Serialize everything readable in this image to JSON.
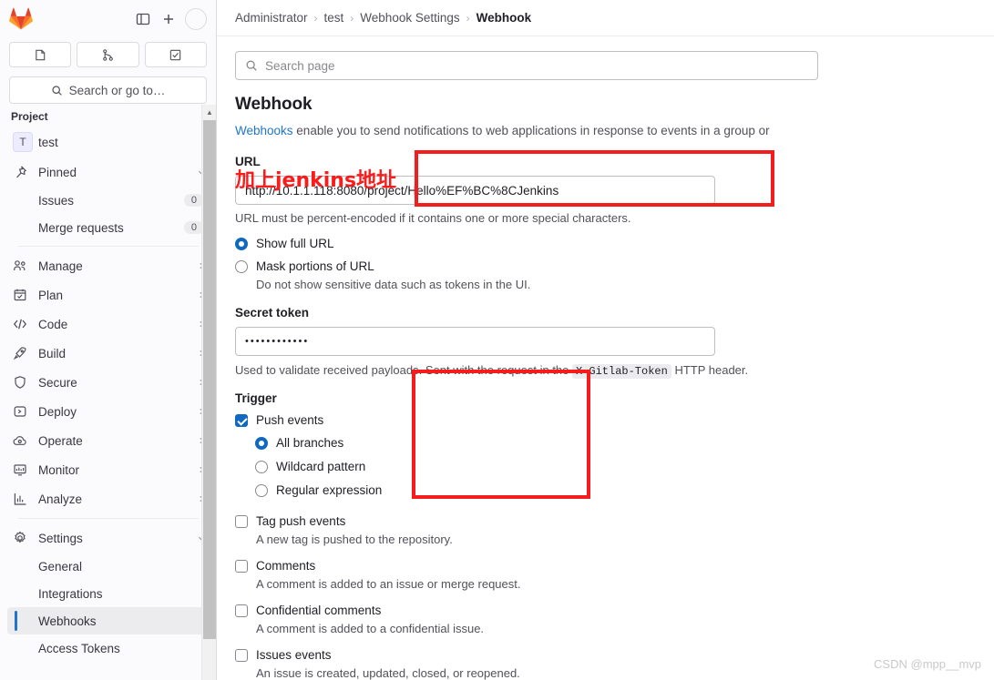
{
  "sidebar": {
    "logo_icon": "gitlab-fox-logo",
    "toggle_icon": "sidebar-toggle-icon",
    "new_icon": "plus-icon",
    "avatar_icon": "user-avatar",
    "quick_actions": [
      {
        "name": "issues",
        "icon": "issue-icon"
      },
      {
        "name": "merge-requests",
        "icon": "merge-request-icon"
      },
      {
        "name": "todos",
        "icon": "todo-checkbox-icon"
      }
    ],
    "search": {
      "label": "Search or go to…",
      "icon": "search-icon"
    },
    "section_label": "Project",
    "project": {
      "initial": "T",
      "name": "test"
    },
    "pinned": {
      "label": "Pinned",
      "icon": "pin-icon",
      "chevron": "chevron-down-icon",
      "items": [
        {
          "label": "Issues",
          "count": "0"
        },
        {
          "label": "Merge requests",
          "count": "0"
        }
      ]
    },
    "groups": [
      {
        "label": "Manage",
        "icon": "users-icon",
        "chevron": "chevron-right-icon"
      },
      {
        "label": "Plan",
        "icon": "calendar-icon",
        "chevron": "chevron-right-icon"
      },
      {
        "label": "Code",
        "icon": "code-icon",
        "chevron": "chevron-right-icon"
      },
      {
        "label": "Build",
        "icon": "rocket-icon",
        "chevron": "chevron-right-icon"
      },
      {
        "label": "Secure",
        "icon": "shield-icon",
        "chevron": "chevron-right-icon"
      },
      {
        "label": "Deploy",
        "icon": "deploy-icon",
        "chevron": "chevron-right-icon"
      },
      {
        "label": "Operate",
        "icon": "cloud-gear-icon",
        "chevron": "chevron-right-icon"
      },
      {
        "label": "Monitor",
        "icon": "monitor-icon",
        "chevron": "chevron-right-icon"
      },
      {
        "label": "Analyze",
        "icon": "chart-icon",
        "chevron": "chevron-right-icon"
      }
    ],
    "settings": {
      "label": "Settings",
      "icon": "gear-icon",
      "chevron": "chevron-down-icon",
      "items": [
        {
          "label": "General",
          "active": false
        },
        {
          "label": "Integrations",
          "active": false
        },
        {
          "label": "Webhooks",
          "active": true
        },
        {
          "label": "Access Tokens",
          "active": false
        }
      ]
    }
  },
  "breadcrumb": {
    "items": [
      "Administrator",
      "test",
      "Webhook Settings"
    ],
    "current": "Webhook",
    "separator": "›"
  },
  "search_page": {
    "placeholder": "Search page",
    "icon": "search-icon"
  },
  "main": {
    "title": "Webhook",
    "description_link": "Webhooks",
    "description_rest": " enable you to send notifications to web applications in response to events in a group or",
    "url_field": {
      "label": "URL",
      "value": "http://10.1.1.118:8080/project/Hello%EF%BC%8CJenkins",
      "help": "URL must be percent-encoded if it contains one or more special characters."
    },
    "url_mode": {
      "options": [
        {
          "label": "Show full URL",
          "checked": true,
          "desc": ""
        },
        {
          "label": "Mask portions of URL",
          "checked": false,
          "desc": "Do not show sensitive data such as tokens in the UI."
        }
      ]
    },
    "secret_token": {
      "label": "Secret token",
      "value": "••••••••••••",
      "help_before": "Used to validate received payloads. Sent with the request in the ",
      "help_code": "X-Gitlab-Token",
      "help_after": " HTTP header."
    },
    "trigger": {
      "title": "Trigger",
      "push_events": {
        "label": "Push events",
        "checked": true
      },
      "branch_options": [
        {
          "label": "All branches",
          "checked": true
        },
        {
          "label": "Wildcard pattern",
          "checked": false
        },
        {
          "label": "Regular expression",
          "checked": false
        }
      ],
      "events": [
        {
          "label": "Tag push events",
          "checked": false,
          "desc": "A new tag is pushed to the repository."
        },
        {
          "label": "Comments",
          "checked": false,
          "desc": "A comment is added to an issue or merge request."
        },
        {
          "label": "Confidential comments",
          "checked": false,
          "desc": "A comment is added to a confidential issue."
        },
        {
          "label": "Issues events",
          "checked": false,
          "desc": "An issue is created, updated, closed, or reopened."
        }
      ]
    }
  },
  "annotations": {
    "note_text": "加上jenkins地址",
    "accent_red": "#f41d1d"
  },
  "watermark": "CSDN @mpp__mvp"
}
